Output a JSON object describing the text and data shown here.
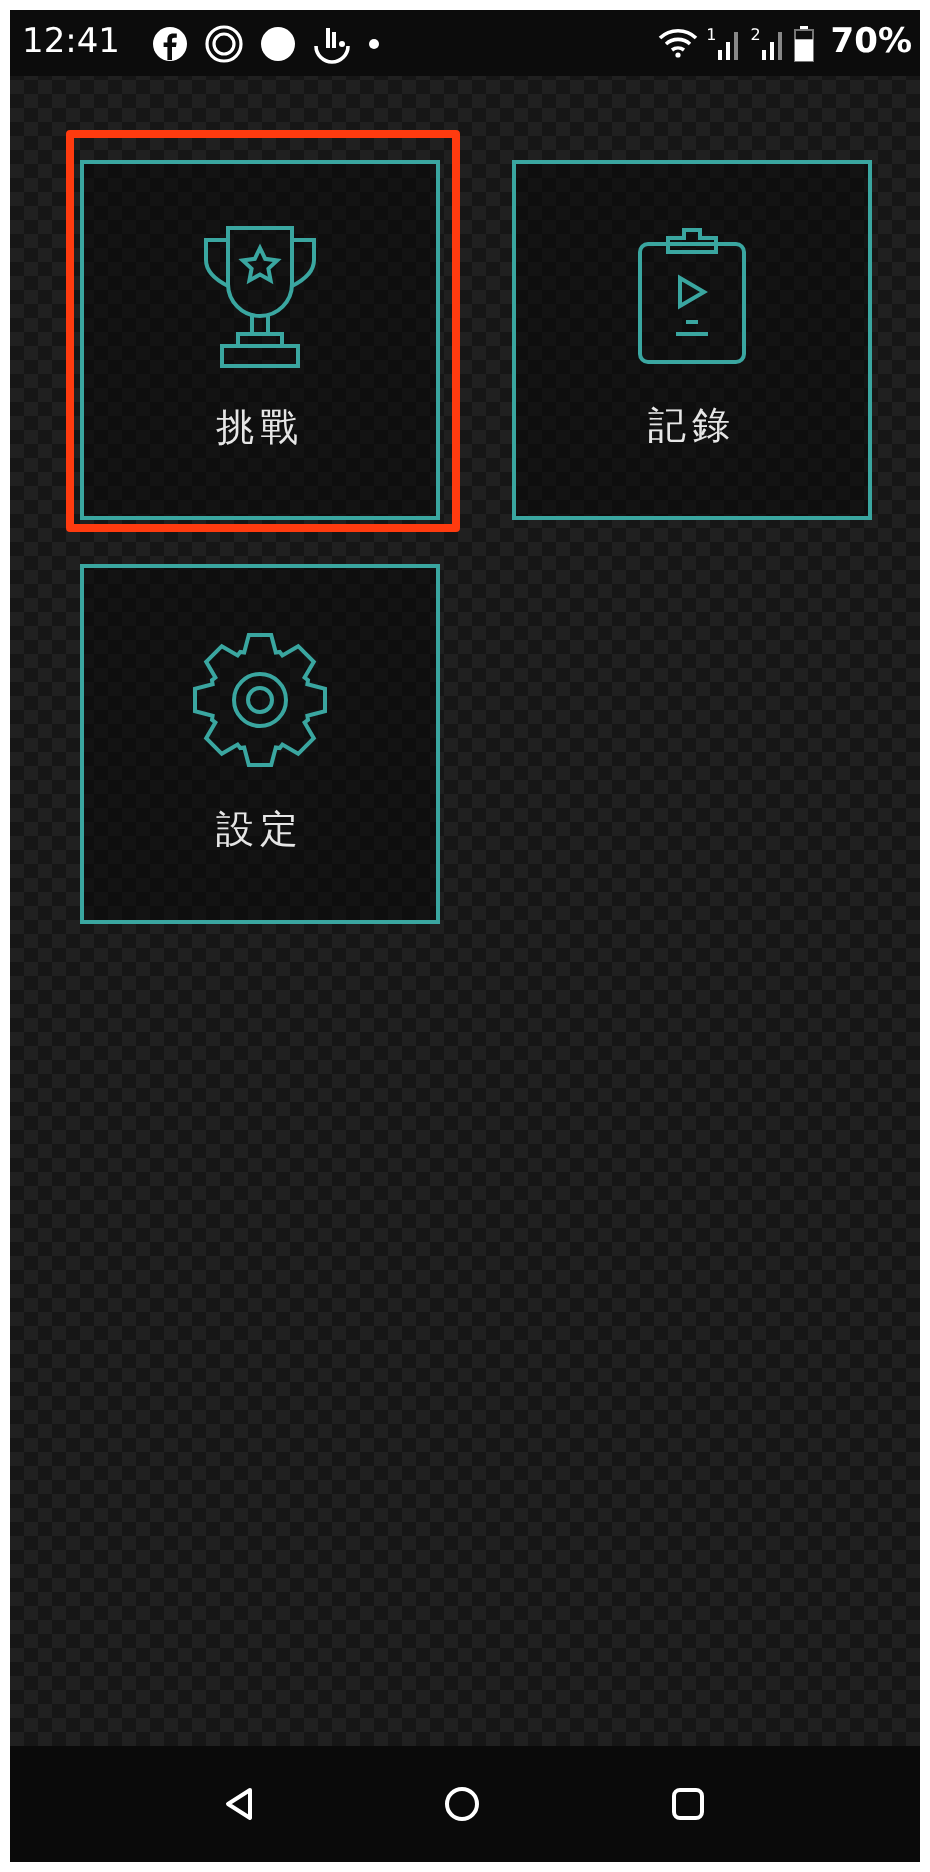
{
  "status_bar": {
    "time": "12:41",
    "sims": [
      {
        "label": "1"
      },
      {
        "label": "2"
      }
    ],
    "battery": {
      "reading": "70%"
    }
  },
  "tiles": [
    {
      "kind": "trophy",
      "label": "挑戰",
      "selected": true
    },
    {
      "kind": "clipboard",
      "label": "記錄",
      "selected": false
    },
    {
      "kind": "gear",
      "label": "設定",
      "selected": false
    }
  ]
}
